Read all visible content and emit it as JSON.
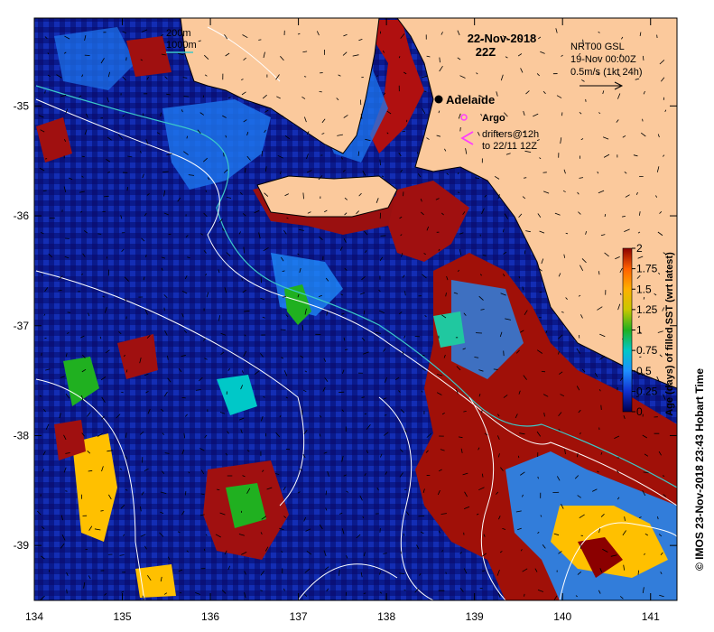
{
  "map": {
    "date": "22-Nov-2018",
    "time": "22Z",
    "lon_ticks": [
      134,
      135,
      136,
      137,
      138,
      139,
      140,
      141
    ],
    "lat_ticks": [
      -35,
      -36,
      -37,
      -38,
      -39
    ],
    "lon_labels": [
      "134",
      "135",
      "136",
      "137",
      "138",
      "139",
      "140",
      "141"
    ],
    "lat_labels": [
      "-35",
      "-36",
      "-37",
      "-38",
      "-39"
    ],
    "lon_range": [
      134,
      141.3
    ],
    "lat_range": [
      -39.5,
      -34.2
    ],
    "colors": {
      "land": "#fbc99c",
      "ocean_fresh": "#0a1a8c",
      "coast": "#000000",
      "isobath": "#ffffff"
    }
  },
  "depth_legend": {
    "line1": "200m",
    "line2": "1000m",
    "line2_color": "#3cc8c8"
  },
  "current_legend": {
    "product": "NRT00 GSL",
    "valid": "19-Nov 00:00Z",
    "scale": "0.5m/s (1kt 24h)"
  },
  "city": {
    "name": "Adelaide",
    "lon": 138.6,
    "lat": -34.93
  },
  "argo": {
    "label": "Argo",
    "color": "#ff3cff"
  },
  "drifters": {
    "line1": "drifters@12h",
    "line2": "to 22/11 12Z",
    "color": "#ff3cff"
  },
  "colorbar": {
    "title": "Age (days) of filled SST (wrt latest)",
    "range": [
      0,
      2
    ],
    "tick_labels": [
      "0",
      "0.25",
      "0.5",
      "0.75",
      "1",
      "1.25",
      "1.5",
      "1.75",
      "2"
    ],
    "stops": [
      "#000050",
      "#1030d0",
      "#1e90ff",
      "#00c8c8",
      "#20b020",
      "#c8c800",
      "#ffb000",
      "#ff6000",
      "#8b0000"
    ]
  },
  "credit": "© IMOS 23-Nov-2018 23:43 Hobart Time"
}
